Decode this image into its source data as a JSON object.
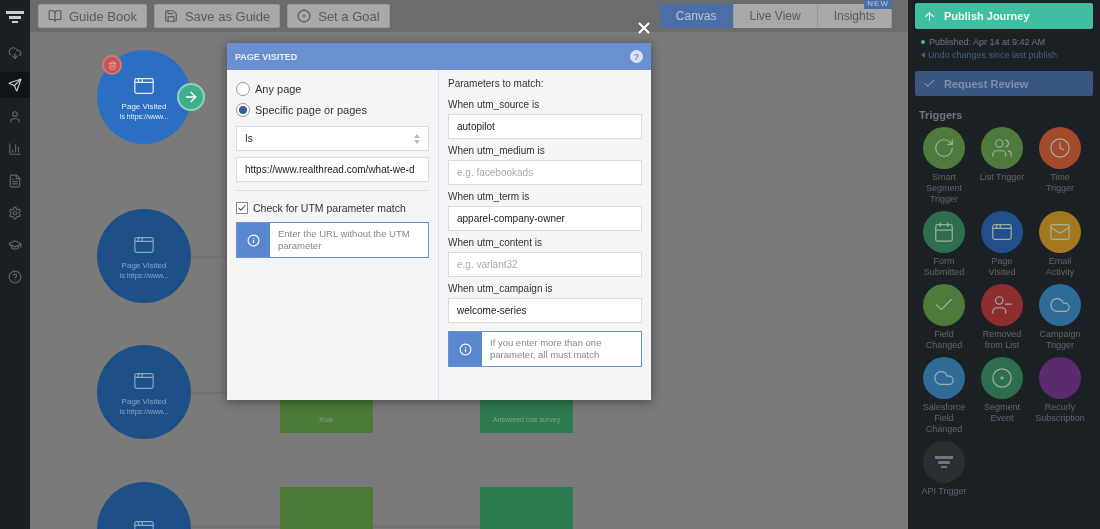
{
  "nav_items": [
    {
      "selected": false
    },
    {
      "selected": true
    },
    {
      "selected": false
    },
    {
      "selected": false
    },
    {
      "selected": false
    },
    {
      "selected": false
    },
    {
      "selected": false
    },
    {
      "selected": false
    }
  ],
  "toolbar": {
    "buttons": [
      "Guide Book",
      "Save as Guide",
      "Set a Goal"
    ],
    "view_tabs": [
      {
        "label": "Canvas",
        "selected": true
      },
      {
        "label": "Live View",
        "selected": false
      },
      {
        "label": "Insights",
        "selected": false,
        "badge": "NEW"
      }
    ]
  },
  "canvas": {
    "nodes": [
      {
        "kind": "trigger",
        "title": "Page Visited",
        "subtitle": "Is https://www...",
        "selected": true
      },
      {
        "kind": "trigger",
        "title": "Page Visited",
        "subtitle": "Is https://www...",
        "selected": false
      },
      {
        "kind": "trigger",
        "title": "Page Visited",
        "subtitle": "Is https://www...",
        "selected": false
      },
      {
        "kind": "trigger",
        "selected": false
      },
      {
        "kind": "action",
        "label": "Role"
      },
      {
        "kind": "action",
        "label": "Answered role survey"
      },
      {
        "kind": "action"
      },
      {
        "kind": "action"
      }
    ]
  },
  "dialog": {
    "title": "PAGE VISITED",
    "help": "?",
    "radios": [
      {
        "label": "Any page",
        "selected": false
      },
      {
        "label": "Specific page or pages",
        "selected": true
      }
    ],
    "match_select": "Is",
    "url_field": "https://www.realthread.com/what-we-d",
    "utm_check": {
      "label": "Check for UTM parameter match",
      "checked": true
    },
    "url_note": "Enter the URL without the UTM parameter",
    "params_heading": "Parameters to match:",
    "params": [
      {
        "label": "When utm_source is",
        "value": "autopilot"
      },
      {
        "label": "When utm_medium is",
        "placeholder": "e.g. facebookads"
      },
      {
        "label": "When utm_term is",
        "value": "apparel-company-owner"
      },
      {
        "label": "When utm_content is",
        "placeholder": "e.g. variant32"
      },
      {
        "label": "When utm_campaign is",
        "value": "welcome-series"
      }
    ],
    "params_note": "If you enter more than one parameter, all must match"
  },
  "sidebar": {
    "publish_button": "Publish Journey",
    "published_status": "Published: Apr 14 at 9:42 AM",
    "undo_link": "Undo changes since last publish",
    "review_button": "Request Review",
    "triggers_heading": "Triggers",
    "triggers": [
      {
        "label": "Smart Segment Trigger",
        "color": "#4e7a3c"
      },
      {
        "label": "List Trigger",
        "color": "#4e7a3c"
      },
      {
        "label": "Time Trigger",
        "color": "#a24a2a"
      },
      {
        "label": "Form Submitted",
        "color": "#2e6e4e"
      },
      {
        "label": "Page Visited",
        "color": "#224f8a"
      },
      {
        "label": "Email Activity",
        "color": "#a3781e"
      },
      {
        "label": "Field Changed",
        "color": "#4e7a3c"
      },
      {
        "label": "Removed from List",
        "color": "#8e2e2e"
      },
      {
        "label": "Campaign Trigger",
        "color": "#2e6b96"
      },
      {
        "label": "Salesforce Field Changed",
        "color": "#2e6b96"
      },
      {
        "label": "Segment Event",
        "color": "#2e6e4e"
      },
      {
        "label": "Recurly Subscription",
        "color": "#5a2c6e"
      },
      {
        "label": "API Trigger",
        "color": "#2a2f34"
      }
    ]
  }
}
